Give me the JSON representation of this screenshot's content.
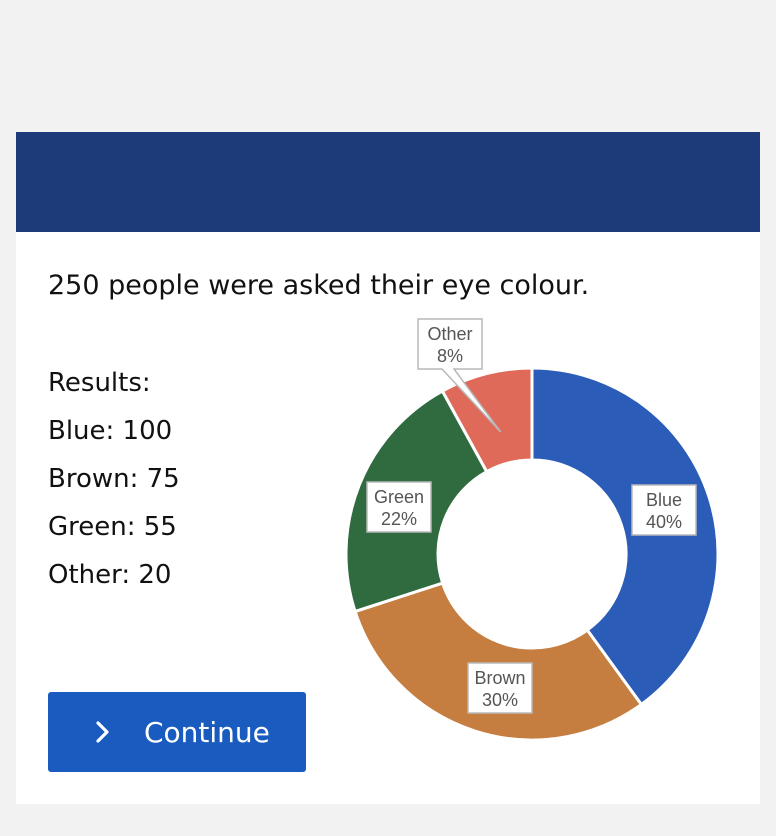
{
  "question": "250 people were asked their eye colour.",
  "results": {
    "heading": "Results:",
    "items": [
      "Blue: 100",
      "Brown: 75",
      "Green: 55",
      "Other: 20"
    ]
  },
  "continue_button": {
    "label": "Continue",
    "icon": "chevron-right-icon"
  },
  "colors": {
    "header": "#1d3b78",
    "button": "#1a5bbf"
  },
  "chart_data": {
    "type": "pie",
    "donut": true,
    "legend": "none",
    "slices": [
      {
        "label": "Blue",
        "value": 100,
        "percent_label": "40%",
        "color": "#2a5cb8"
      },
      {
        "label": "Brown",
        "value": 75,
        "percent_label": "30%",
        "color": "#c57e40"
      },
      {
        "label": "Green",
        "value": 55,
        "percent_label": "22%",
        "color": "#2f6b3f"
      },
      {
        "label": "Other",
        "value": 20,
        "percent_label": "8%",
        "color": "#e06a5a"
      }
    ]
  }
}
